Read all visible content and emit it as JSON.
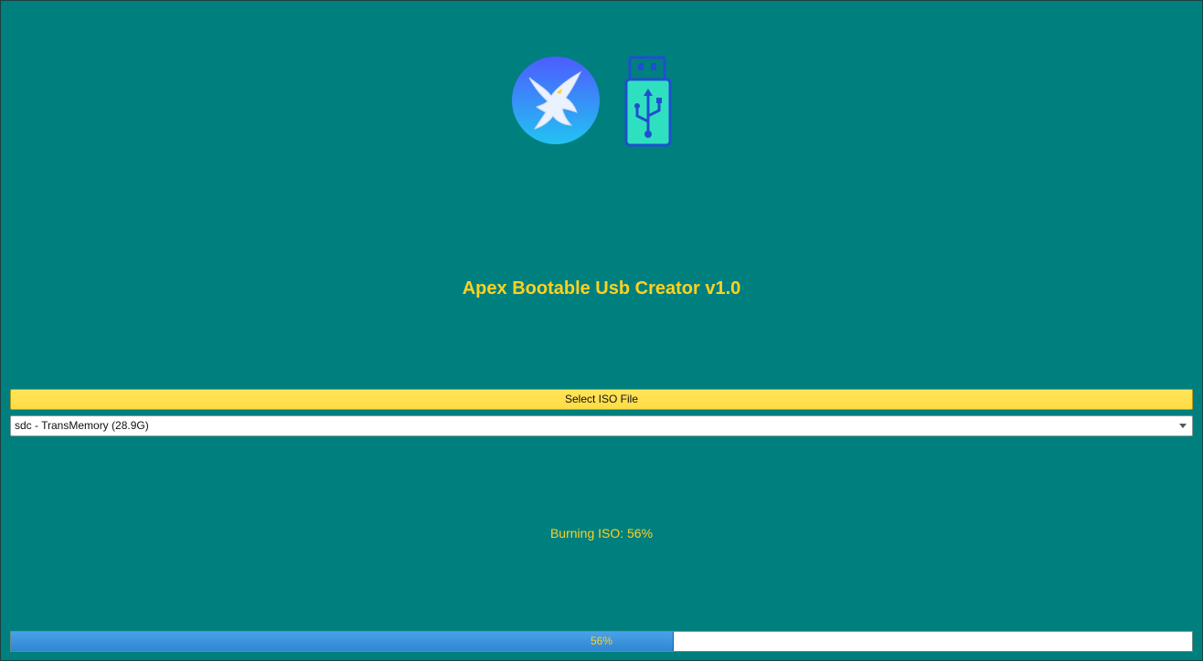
{
  "app": {
    "title": "Apex Bootable Usb Creator v1.0"
  },
  "logos": {
    "left_icon": "eagle-icon",
    "right_icon": "usb-drive-icon"
  },
  "buttons": {
    "select_iso_label": "Select ISO File"
  },
  "device_select": {
    "selected": "sdc - TransMemory (28.9G)"
  },
  "status": {
    "text": "Burning ISO: 56%"
  },
  "progress": {
    "value": 0.56,
    "label": "56%"
  },
  "colors": {
    "background": "#007f7f",
    "accent_text": "#ffd21f",
    "button": "#ffdc45",
    "progress_fill": "#3a93dc"
  }
}
